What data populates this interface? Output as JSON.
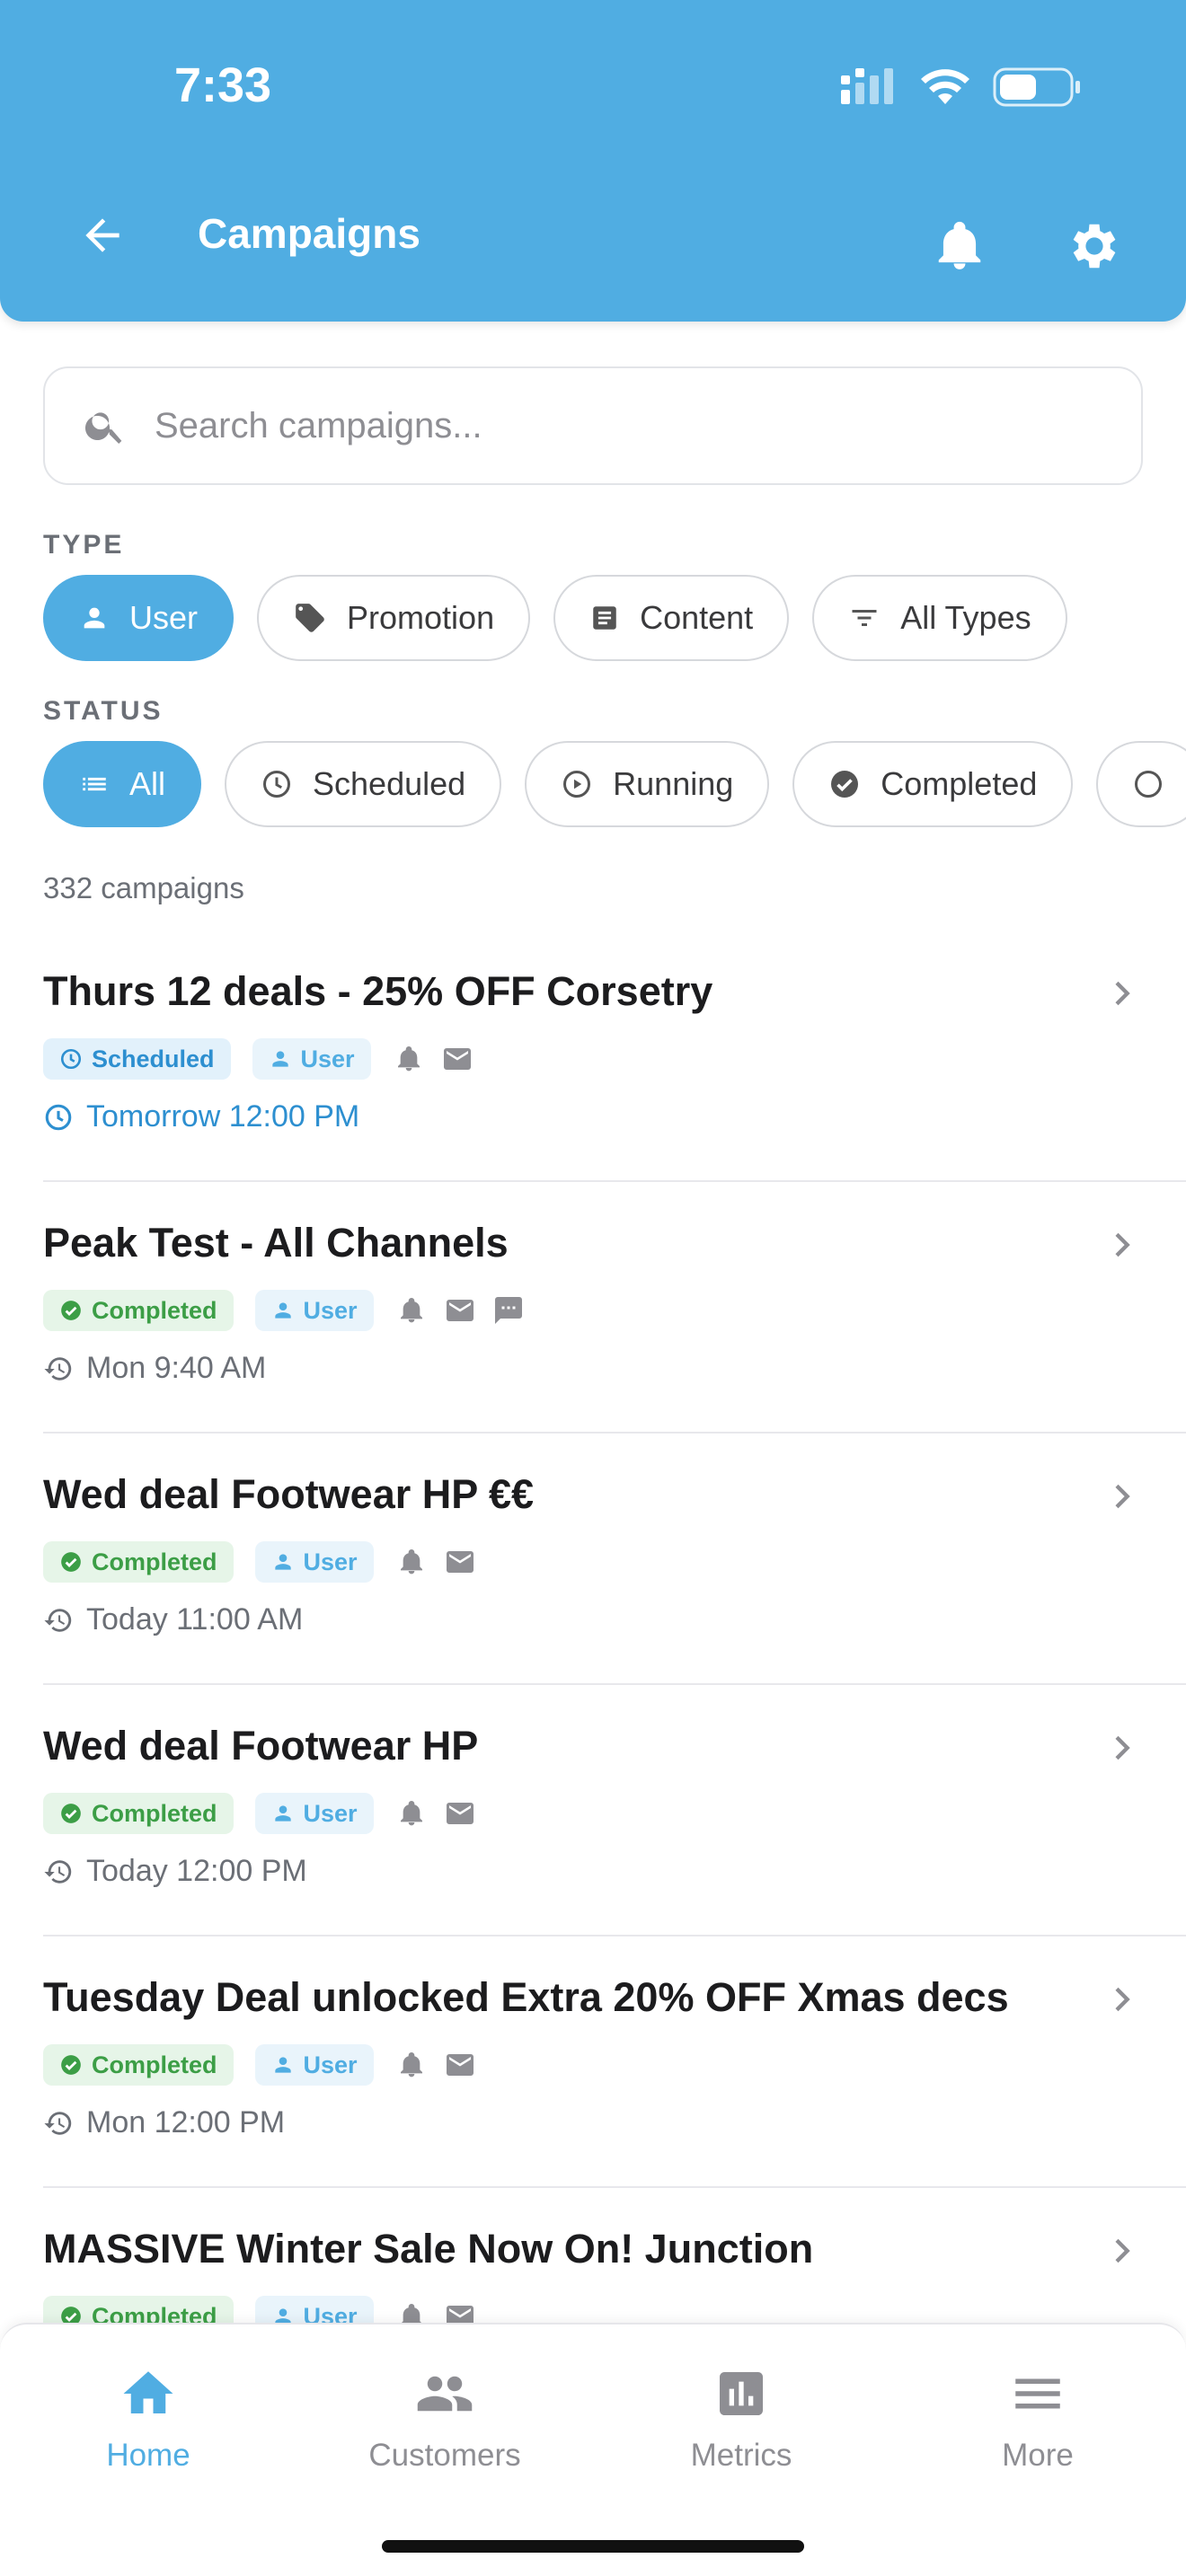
{
  "status_bar": {
    "time": "7:33"
  },
  "header": {
    "title": "Campaigns"
  },
  "search": {
    "placeholder": "Search campaigns..."
  },
  "filters": {
    "type_label": "TYPE",
    "type_chips": [
      {
        "label": "User",
        "icon": "person-icon",
        "active": true
      },
      {
        "label": "Promotion",
        "icon": "tag-icon",
        "active": false
      },
      {
        "label": "Content",
        "icon": "document-icon",
        "active": false
      },
      {
        "label": "All Types",
        "icon": "filter-icon",
        "active": false
      }
    ],
    "status_label": "STATUS",
    "status_chips": [
      {
        "label": "All",
        "icon": "list-icon",
        "active": true
      },
      {
        "label": "Scheduled",
        "icon": "clock-icon",
        "active": false
      },
      {
        "label": "Running",
        "icon": "play-icon",
        "active": false
      },
      {
        "label": "Completed",
        "icon": "check-circle-icon",
        "active": false
      }
    ]
  },
  "campaign_count": "332 campaigns",
  "campaigns": [
    {
      "title": "Thurs 12 deals - 25% OFF Corsetry",
      "status": "Scheduled",
      "type": "User",
      "channels": [
        "push",
        "email"
      ],
      "time": "Tomorrow 12:00 PM"
    },
    {
      "title": "Peak Test - All Channels",
      "status": "Completed",
      "type": "User",
      "channels": [
        "push",
        "email",
        "sms"
      ],
      "time": "Mon 9:40 AM"
    },
    {
      "title": "Wed deal Footwear HP €€",
      "status": "Completed",
      "type": "User",
      "channels": [
        "push",
        "email"
      ],
      "time": "Today 11:00 AM"
    },
    {
      "title": "Wed deal Footwear HP",
      "status": "Completed",
      "type": "User",
      "channels": [
        "push",
        "email"
      ],
      "time": "Today 12:00 PM"
    },
    {
      "title": "Tuesday Deal unlocked Extra 20% OFF Xmas decs",
      "status": "Completed",
      "type": "User",
      "channels": [
        "push",
        "email"
      ],
      "time": "Mon 12:00 PM"
    },
    {
      "title": "MASSIVE Winter Sale Now On! Junction",
      "status": "Completed",
      "type": "User",
      "channels": [
        "push",
        "email"
      ],
      "time": ""
    }
  ],
  "tabbar": {
    "tabs": [
      {
        "label": "Home",
        "icon": "home-icon",
        "active": true
      },
      {
        "label": "Customers",
        "icon": "people-icon",
        "active": false
      },
      {
        "label": "Metrics",
        "icon": "bar-chart-icon",
        "active": false
      },
      {
        "label": "More",
        "icon": "menu-icon",
        "active": false
      }
    ]
  },
  "colors": {
    "primary": "#50ade2",
    "completed": "#3c9e46",
    "scheduled": "#2d8fd0"
  }
}
